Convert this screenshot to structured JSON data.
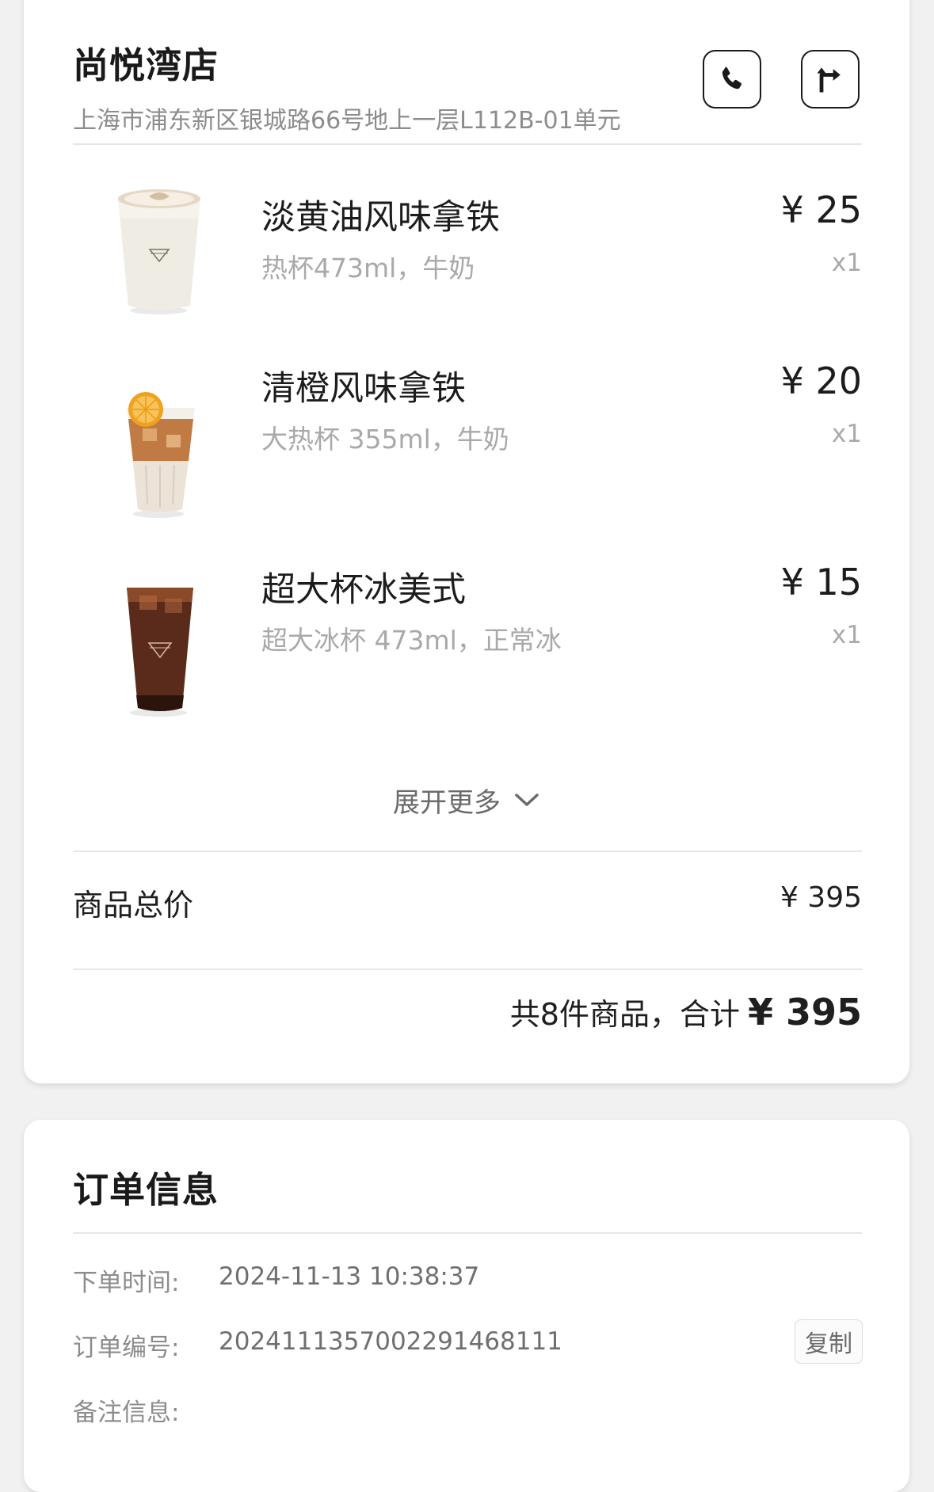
{
  "store": {
    "name": "尚悦湾店",
    "address": "上海市浦东新区银城路66号地上一层L112B-01单元"
  },
  "products": [
    {
      "name": "淡黄油风味拿铁",
      "spec": "热杯473ml，牛奶",
      "price": "¥ 25",
      "qty": "x1"
    },
    {
      "name": "清橙风味拿铁",
      "spec": "大热杯 355ml，牛奶",
      "price": "¥ 20",
      "qty": "x1"
    },
    {
      "name": "超大杯冰美式",
      "spec": "超大冰杯 473ml，正常冰",
      "price": "¥ 15",
      "qty": "x1"
    }
  ],
  "expand_label": "展开更多",
  "summary": {
    "label": "商品总价",
    "value": "¥ 395",
    "total_prefix": "共8件商品，合计",
    "total_amount": "¥ 395"
  },
  "order_info": {
    "title": "订单信息",
    "time_label": "下单时间:",
    "time_value": "2024-11-13 10:38:37",
    "number_label": "订单编号:",
    "number_value": "20241113570022914681​11",
    "copy_label": "复制",
    "note_label": "备注信息:"
  },
  "icons": {
    "phone": "phone-icon",
    "navigate": "navigation-icon",
    "expand": "chevron-down-icon"
  }
}
